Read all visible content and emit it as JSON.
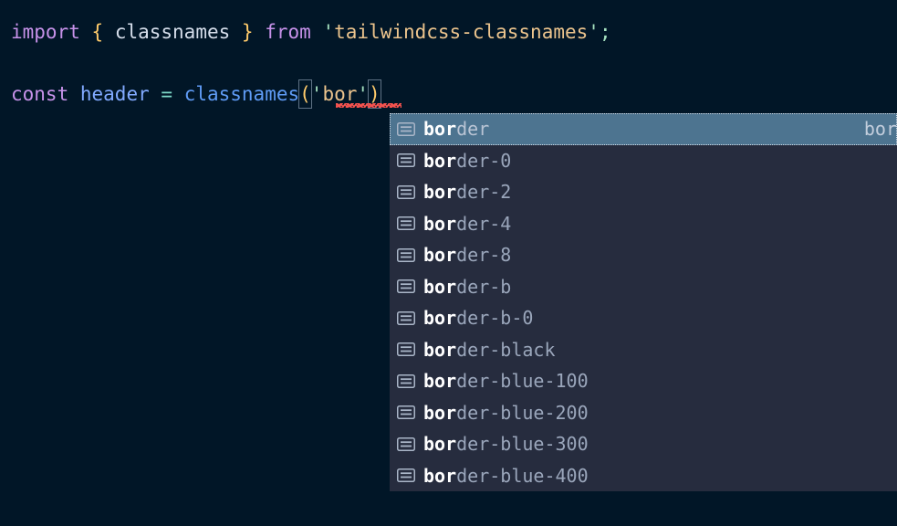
{
  "theme": {
    "editor_background": "#011627",
    "popup_background": "#262c3e",
    "selection_background": "#4d7490",
    "keyword_color": "#c792ea",
    "string_color": "#ecc48d",
    "function_color": "#5f9bf5",
    "variable_color": "#82aaff",
    "operator_color": "#7fdbca",
    "bracket_color": "#ffcb6b",
    "error_squiggle_color": "#f7534f",
    "match_text_color": "#ffffff",
    "muted_text_color": "#9aa6bb"
  },
  "editor": {
    "line1": {
      "keyword_import": "import",
      "brace_open": "{",
      "binding": "classnames",
      "brace_close": "}",
      "keyword_from": "from",
      "quote_open": "'",
      "module": "tailwindcss-classnames",
      "quote_close": "'",
      "semicolon": ";"
    },
    "line2": {
      "keyword_const": "const",
      "variable": "header",
      "operator": "=",
      "function": "classnames",
      "paren_open": "(",
      "quote_open": "'",
      "argument": "bor",
      "quote_close": "'",
      "paren_close": ")"
    }
  },
  "autocomplete": {
    "icon_name": "text-snippet-icon",
    "match_prefix": "bor",
    "selected_index": 0,
    "selected_detail": "bor",
    "items": [
      {
        "label": "border",
        "match": "bor",
        "rest": "der"
      },
      {
        "label": "border-0",
        "match": "bor",
        "rest": "der-0"
      },
      {
        "label": "border-2",
        "match": "bor",
        "rest": "der-2"
      },
      {
        "label": "border-4",
        "match": "bor",
        "rest": "der-4"
      },
      {
        "label": "border-8",
        "match": "bor",
        "rest": "der-8"
      },
      {
        "label": "border-b",
        "match": "bor",
        "rest": "der-b"
      },
      {
        "label": "border-b-0",
        "match": "bor",
        "rest": "der-b-0"
      },
      {
        "label": "border-black",
        "match": "bor",
        "rest": "der-black"
      },
      {
        "label": "border-blue-100",
        "match": "bor",
        "rest": "der-blue-100"
      },
      {
        "label": "border-blue-200",
        "match": "bor",
        "rest": "der-blue-200"
      },
      {
        "label": "border-blue-300",
        "match": "bor",
        "rest": "der-blue-300"
      },
      {
        "label": "border-blue-400",
        "match": "bor",
        "rest": "der-blue-400"
      }
    ]
  }
}
